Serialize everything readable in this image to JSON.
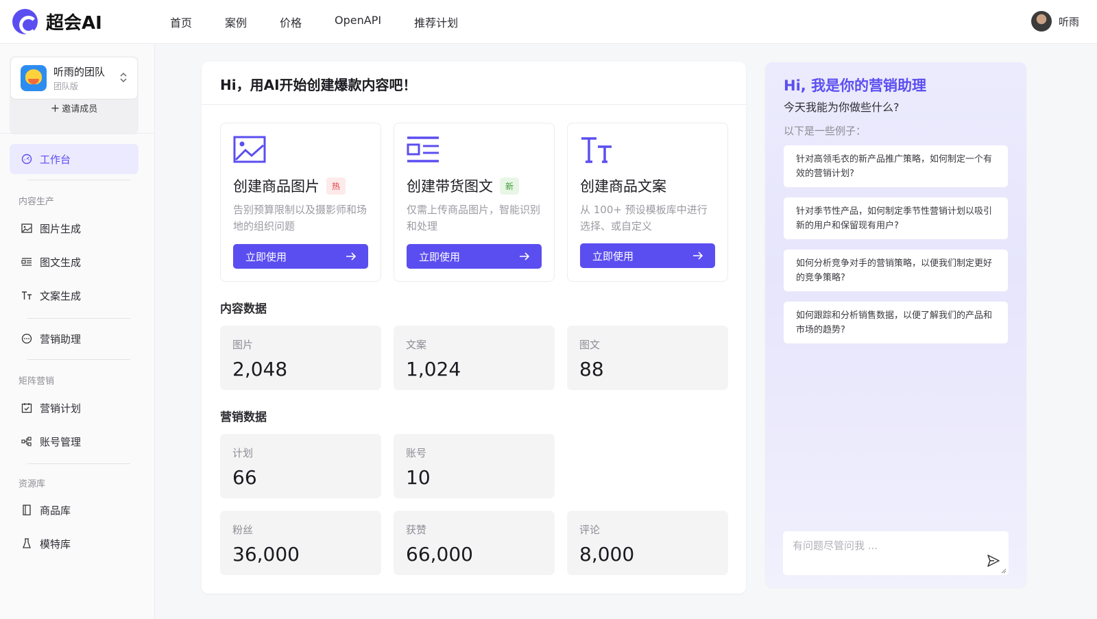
{
  "app": {
    "name": "超会AI",
    "brand_color": "#5b4ef0"
  },
  "nav": [
    {
      "label": "首页"
    },
    {
      "label": "案例"
    },
    {
      "label": "价格"
    },
    {
      "label": "OpenAPI"
    },
    {
      "label": "推荐计划"
    }
  ],
  "user": {
    "name": "听雨"
  },
  "sidebar": {
    "team": {
      "name": "听雨的团队",
      "plan": "团队版",
      "invite_label": "邀请成员"
    },
    "workbench": {
      "label": "工作台",
      "icon": "dashboard-icon"
    },
    "groups": {
      "content": "内容生产",
      "matrix": "矩阵营销",
      "library": "资源库"
    },
    "items": {
      "image_gen": {
        "label": "图片生成",
        "icon": "image-icon"
      },
      "article_gen": {
        "label": "图文生成",
        "icon": "layout-icon"
      },
      "copy_gen": {
        "label": "文案生成",
        "icon": "text-icon"
      },
      "assistant": {
        "label": "营销助理",
        "icon": "chat-icon"
      },
      "plan": {
        "label": "营销计划",
        "icon": "calendar-check-icon"
      },
      "accounts": {
        "label": "账号管理",
        "icon": "cluster-icon"
      },
      "products": {
        "label": "商品库",
        "icon": "book-icon"
      },
      "models": {
        "label": "模特库",
        "icon": "model-icon"
      }
    }
  },
  "main": {
    "title": "Hi，用AI开始创建爆款内容吧！",
    "features": [
      {
        "title": "创建商品图片",
        "tag": "热",
        "desc": "告别预算限制以及摄影师和场地的组织问题",
        "button": "立即使用",
        "icon": "image-icon"
      },
      {
        "title": "创建带货图文",
        "tag": "新",
        "desc": "仅需上传商品图片，智能识别和处理",
        "button": "立即使用",
        "icon": "layout-icon"
      },
      {
        "title": "创建商品文案",
        "tag": "",
        "desc": "从 100+ 预设模板库中进行选择、或自定义",
        "button": "立即使用",
        "icon": "text-icon"
      }
    ],
    "content_section": "内容数据",
    "content_stats": [
      {
        "label": "图片",
        "value": "2,048"
      },
      {
        "label": "文案",
        "value": "1,024"
      },
      {
        "label": "图文",
        "value": "88"
      }
    ],
    "marketing_section": "营销数据",
    "marketing_stats": [
      {
        "label": "计划",
        "value": "66"
      },
      {
        "label": "账号",
        "value": "10"
      },
      {
        "label": "粉丝",
        "value": "36,000"
      },
      {
        "label": "获赞",
        "value": "66,000"
      },
      {
        "label": "评论",
        "value": "8,000"
      }
    ]
  },
  "assistant": {
    "title": "Hi, 我是你的营销助理",
    "subtitle": "今天我能为你做些什么?",
    "hint": "以下是一些例子：",
    "examples": [
      "针对高领毛衣的新产品推广策略，如何制定一个有效的营销计划?",
      "针对季节性产品，如何制定季节性营销计划以吸引新的用户和保留现有用户?",
      "如何分析竞争对手的营销策略，以便我们制定更好的竞争策略?",
      "如何跟踪和分析销售数据，以便了解我们的产品和市场的趋势?"
    ],
    "input_placeholder": "有问题尽管问我 ..."
  }
}
